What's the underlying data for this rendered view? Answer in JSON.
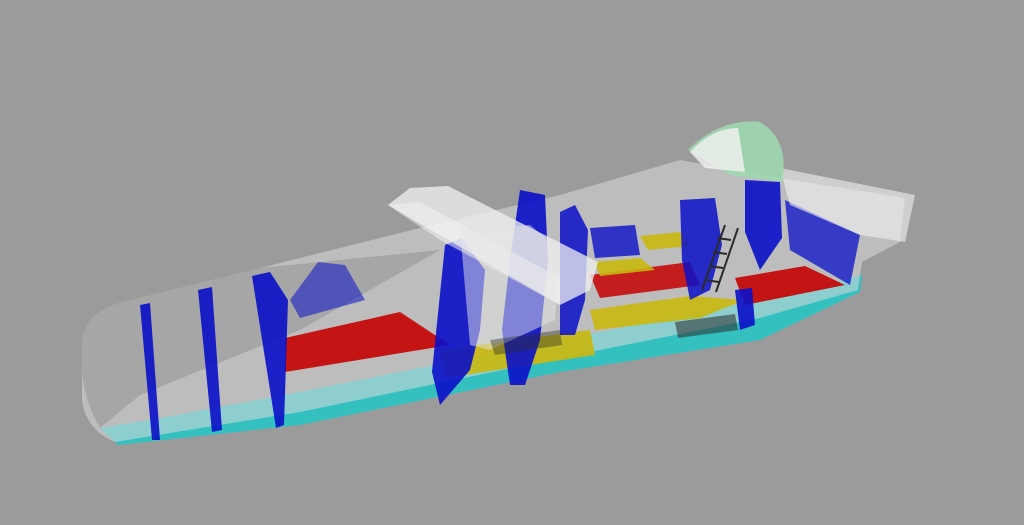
{
  "viewport": {
    "background": "#9b9b9b"
  },
  "model": {
    "colors": {
      "hull_shell": "#d8d8d8",
      "bulkhead": "#0a10c8",
      "deck_red": "#c40b0b",
      "floor_yellow": "#c9b80f",
      "bottom_cyan": "#2fc2c2",
      "canopy_green": "#9ed8b0",
      "structure_white": "#f2f2f2",
      "dark_detail": "#2a2a2a"
    }
  }
}
